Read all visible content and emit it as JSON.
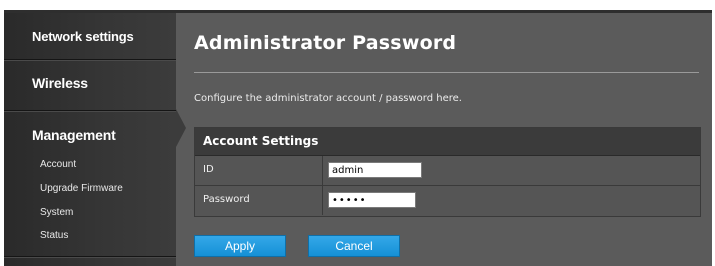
{
  "sidebar": {
    "sections": [
      {
        "label": "Network settings"
      },
      {
        "label": "Wireless"
      },
      {
        "label": "Management"
      }
    ],
    "management_items": [
      "Account",
      "Upgrade Firmware",
      "System",
      "Status"
    ],
    "active_section": "Management"
  },
  "main": {
    "title": "Administrator Password",
    "description": "Configure the administrator account / password here.",
    "panel": {
      "header": "Account Settings",
      "fields": [
        {
          "label": "ID",
          "value": "admin"
        },
        {
          "label": "Password",
          "value": "•••••"
        }
      ]
    },
    "buttons": {
      "apply": "Apply",
      "cancel": "Cancel"
    }
  },
  "colors": {
    "sidebar_bg": "#2f2f2f",
    "content_bg": "#5b5b5b",
    "button_blue": "#1e9be0"
  }
}
